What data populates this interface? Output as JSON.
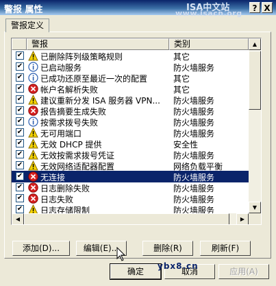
{
  "window": {
    "title": "警报 属性",
    "watermark_top": "ISA中文站",
    "watermark_url": "www.isacn.org",
    "help_label": "?",
    "close_label": "X"
  },
  "tab": {
    "label": "警报定义"
  },
  "columns": [
    "警报",
    "类别"
  ],
  "rows": [
    {
      "icon": "warning",
      "name": "已删除阵列级策略规则",
      "category": "其它",
      "selected": false
    },
    {
      "icon": "info",
      "name": "已启动服务",
      "category": "防火墙服务",
      "selected": false
    },
    {
      "icon": "info",
      "name": "已成功还原至最近一次的配置",
      "category": "其它",
      "selected": false
    },
    {
      "icon": "error",
      "name": "帐户名解析失败",
      "category": "其它",
      "selected": false
    },
    {
      "icon": "warning",
      "name": "建议重新分发 ISA 服务器 VPN...",
      "category": "防火墙服务",
      "selected": false
    },
    {
      "icon": "error",
      "name": "报告摘要生成失败",
      "category": "防火墙服务",
      "selected": false
    },
    {
      "icon": "info",
      "name": "按需求拨号失败",
      "category": "防火墙服务",
      "selected": false
    },
    {
      "icon": "warning",
      "name": "无可用端口",
      "category": "防火墙服务",
      "selected": false
    },
    {
      "icon": "warning",
      "name": "无效 DHCP 提供",
      "category": "安全性",
      "selected": false
    },
    {
      "icon": "warning",
      "name": "无效按需求拨号凭证",
      "category": "防火墙服务",
      "selected": false
    },
    {
      "icon": "warning",
      "name": "无效网络适配器配置",
      "category": "网络负载平衡",
      "selected": false
    },
    {
      "icon": "error",
      "name": "无连接",
      "category": "防火墙服务",
      "selected": true
    },
    {
      "icon": "error",
      "name": "日志删除失败",
      "category": "防火墙服务",
      "selected": false
    },
    {
      "icon": "error",
      "name": "日志失败",
      "category": "防火墙服务",
      "selected": false
    },
    {
      "icon": "warning",
      "name": "日志存储限制",
      "category": "防火墙服务",
      "selected": false
    }
  ],
  "buttons": {
    "add": "添加(D)...",
    "edit": "编辑(E)...",
    "delete": "删除(R)",
    "refresh": "刷新(F)",
    "ok": "确定",
    "cancel": "取消",
    "apply": "应用(A)"
  },
  "footer_watermark": "ybx8.cn",
  "colors": {
    "selection": "#0a246a",
    "titlebar": "#0a246a",
    "face": "#ece9d8"
  }
}
